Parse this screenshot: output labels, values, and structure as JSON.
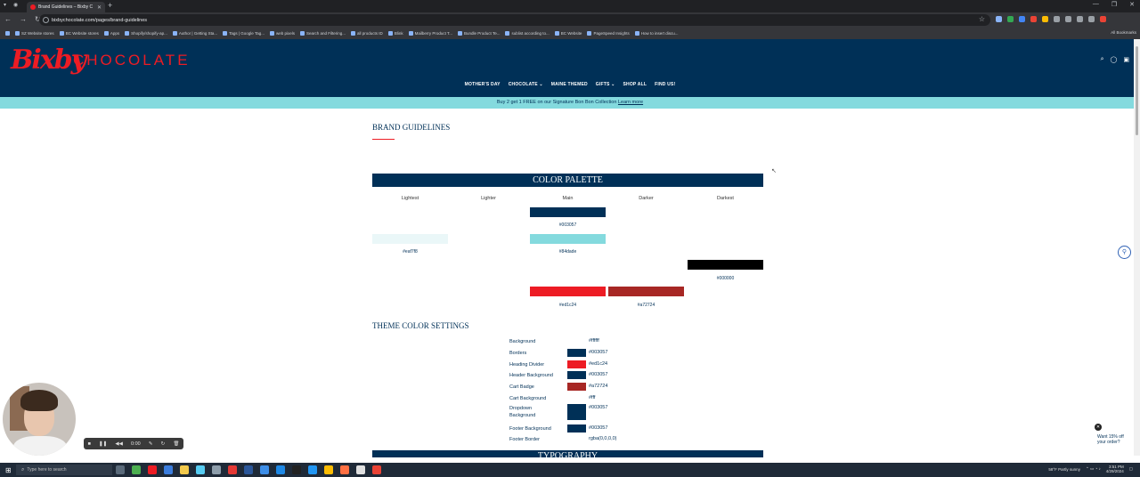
{
  "browser": {
    "tab_title": "Brand Guidelines – Bixby C",
    "url": "bixbychocolate.com/pages/brand-guidelines",
    "bookmarks": [
      "SZ Website stores",
      "BC Website stores",
      "Apps",
      "Shopify/shopify-ap...",
      "Author | Getting Sta...",
      "Tags | Google Tag...",
      "web pixels",
      "Search and Filtering...",
      "all products ID",
      "Blink",
      "Mailberry Product T...",
      "Bundle Product Te...",
      "sublist according to...",
      "BC Website",
      "PageSpeed Insights",
      "How to insert discu..."
    ],
    "all_bookmarks": "All Bookmarks"
  },
  "header": {
    "logo_script": "Bixby",
    "logo_word": "CHOCOLATE",
    "nav": [
      "MOTHER'S DAY",
      "CHOCOLATE ⌄",
      "MAINE THEMED",
      "GIFTS ⌄",
      "SHOP ALL",
      "FIND US!"
    ]
  },
  "promo": {
    "text": "Buy 2 get 1 FREE on our Signature Bon Bon Collection",
    "link": "Learn more"
  },
  "page": {
    "title": "BRAND GUIDELINES",
    "palette_heading": "COLOR PALETTE",
    "columns": [
      "Lightest",
      "Lighter",
      "Main",
      "Darker",
      "Darkest"
    ],
    "swatches": {
      "navy_main": {
        "color": "#003057",
        "code": "#003057"
      },
      "teal_main": {
        "color": "#84dade",
        "code": "#84dade"
      },
      "light_lightest": {
        "color": "#eaf7f8",
        "code": "#eaf7f8"
      },
      "black_darkest": {
        "color": "#000000",
        "code": "#000000"
      },
      "red_main": {
        "color": "#ed1c24",
        "code": "#ed1c24"
      },
      "red_darker": {
        "color": "#a72724",
        "code": "#a72724"
      }
    },
    "theme_heading": "THEME COLOR SETTINGS",
    "theme_settings": [
      {
        "name": "Background",
        "value": "#ffffff",
        "swatch": ""
      },
      {
        "name": "Borders",
        "value": "#003057",
        "swatch": "#003057"
      },
      {
        "name": "Heading Divider",
        "value": "#ed1c24",
        "swatch": "#ed1c24"
      },
      {
        "name": "Header Background",
        "value": "#003057",
        "swatch": "#003057"
      },
      {
        "name": "Cart Badge",
        "value": "#a72724",
        "swatch": "#a72724"
      },
      {
        "name": "Cart Background",
        "value": "#fff",
        "swatch": ""
      },
      {
        "name": "Dropdown Background",
        "value": "#003057",
        "swatch": "#003057"
      },
      {
        "name": "Footer Background",
        "value": "#003057",
        "swatch": "#003057"
      },
      {
        "name": "Footer Border",
        "value": "rgba(0,0,0,0)",
        "swatch": ""
      }
    ],
    "typography_heading": "TYPOGRAPHY"
  },
  "popup": {
    "close": "✕",
    "teaser": "Want 15% off your order?"
  },
  "recorder": {
    "time": "0:00"
  },
  "taskbar": {
    "search_placeholder": "Type here to search",
    "weather": "58°F  Partly sunny",
    "time": "3:51 PM",
    "date": "4/29/2024"
  }
}
